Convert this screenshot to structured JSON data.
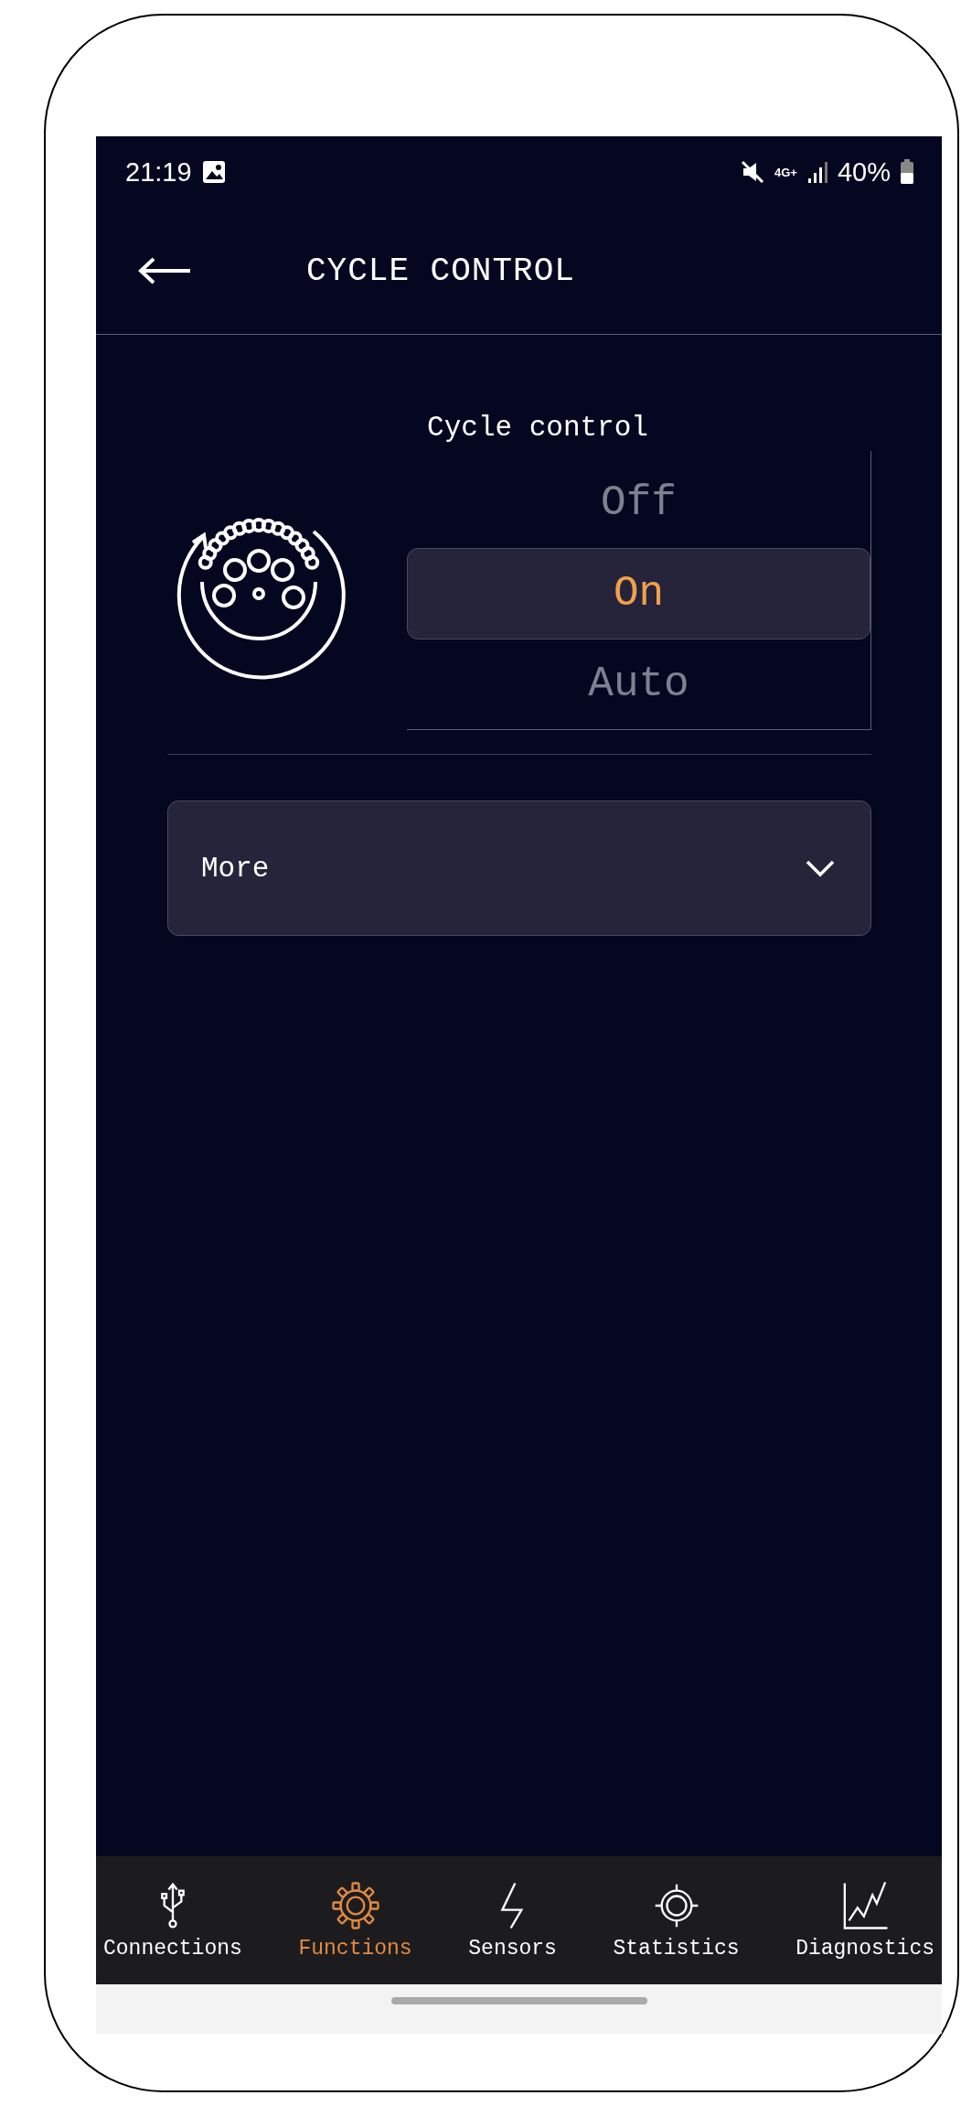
{
  "status_bar": {
    "time": "21:19",
    "network": "4G+",
    "battery": "40%"
  },
  "header": {
    "title": "CYCLE CONTROL"
  },
  "cycle_control": {
    "label": "Cycle control",
    "options": [
      {
        "label": "Off",
        "selected": false
      },
      {
        "label": "On",
        "selected": true
      },
      {
        "label": "Auto",
        "selected": false
      }
    ]
  },
  "more": {
    "label": "More",
    "expanded": false
  },
  "bottom_nav": [
    {
      "kind": "usb",
      "label": "Connections",
      "selected": false
    },
    {
      "kind": "gear",
      "label": "Functions",
      "selected": true
    },
    {
      "kind": "bolt",
      "label": "Sensors",
      "selected": false
    },
    {
      "kind": "target",
      "label": "Statistics",
      "selected": false
    },
    {
      "kind": "chart",
      "label": "Diagnostics",
      "selected": false
    }
  ]
}
